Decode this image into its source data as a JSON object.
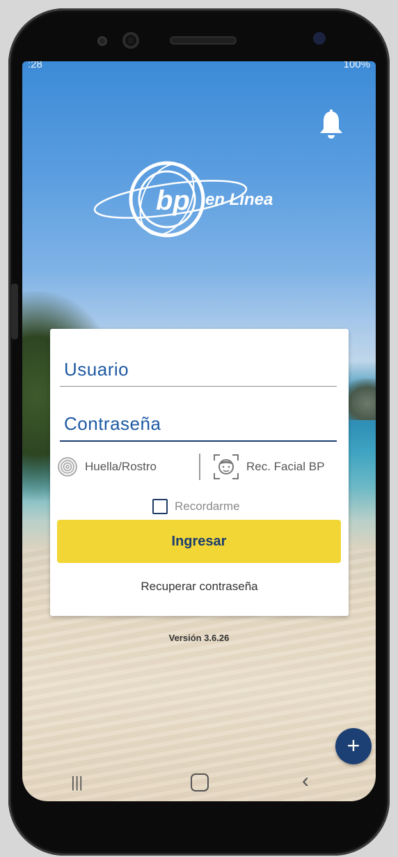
{
  "status_bar": {
    "time": ":28",
    "right_text": "100%"
  },
  "header": {
    "logo_text": "en Linea",
    "logo_emblem": "bp",
    "bell_icon": "notification-bell-icon"
  },
  "login": {
    "username_label": "Usuario",
    "password_label": "Contraseña",
    "biometric_label": "Huella/Rostro",
    "facial_label": "Rec. Facial BP",
    "remember_label": "Recordarme",
    "remember_checked": false,
    "submit_label": "Ingresar",
    "recover_label": "Recuperar contraseña"
  },
  "footer": {
    "version": "Versión 3.6.26"
  },
  "fab": {
    "label": "+"
  },
  "colors": {
    "accent_yellow": "#f2d636",
    "brand_blue": "#1b3d6e",
    "field_text_blue": "#1e5aa3"
  }
}
